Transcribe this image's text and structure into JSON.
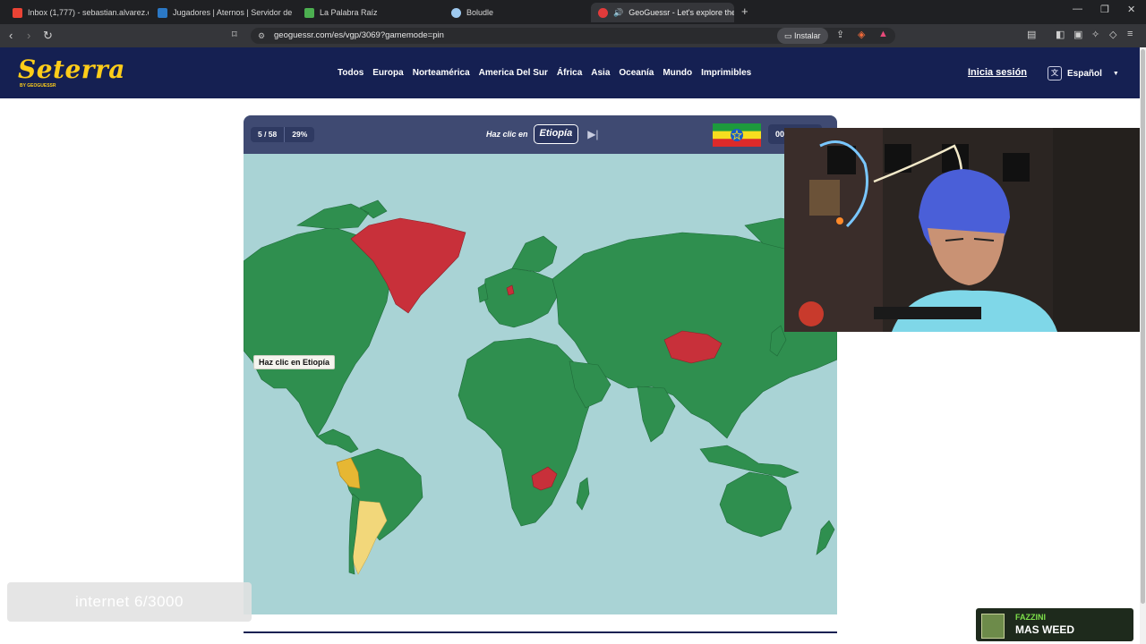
{
  "browser": {
    "tabs": [
      {
        "label": "Inbox (1,777) - sebastian.alvarez.ortiz",
        "icon": "gmail-icon"
      },
      {
        "label": "Jugadores | Aternos | Servidor de Mi",
        "icon": "aternos-icon"
      },
      {
        "label": "La Palabra Raíz",
        "icon": "palabra-icon"
      },
      {
        "label": "Boludle",
        "icon": "boludle-icon"
      },
      {
        "label": "GeoGuessr - Let's explore the",
        "icon": "geoguessr-icon"
      }
    ],
    "url": "geoguessr.com/es/vgp/3069?gamemode=pin",
    "install_label": "Instalar"
  },
  "site": {
    "logo": "Seterra",
    "logo_sub": "BY GEOGUESSR",
    "nav": [
      "Todos",
      "Europa",
      "Norteamérica",
      "America Del Sur",
      "África",
      "Asia",
      "Oceanía",
      "Mundo",
      "Imprimibles"
    ],
    "login": "Inicia sesión",
    "language": "Español"
  },
  "game": {
    "progress": "5 / 58",
    "score": "29%",
    "prompt_label": "Haz clic en",
    "target": "Etiopía",
    "timer": "00",
    "tooltip": "Haz clic en Etiopía",
    "colors": {
      "correct": "#2f8f4f",
      "wrong": "#c8303a",
      "second_try": "#e6b733",
      "third_try": "#f2d77a",
      "ocean": "#a9d3d5",
      "header": "#3f4a72"
    }
  },
  "overlays": {
    "internet": "internet 6/3000",
    "song_artist": "FAZZINI",
    "song_title": "MAS WEED"
  }
}
